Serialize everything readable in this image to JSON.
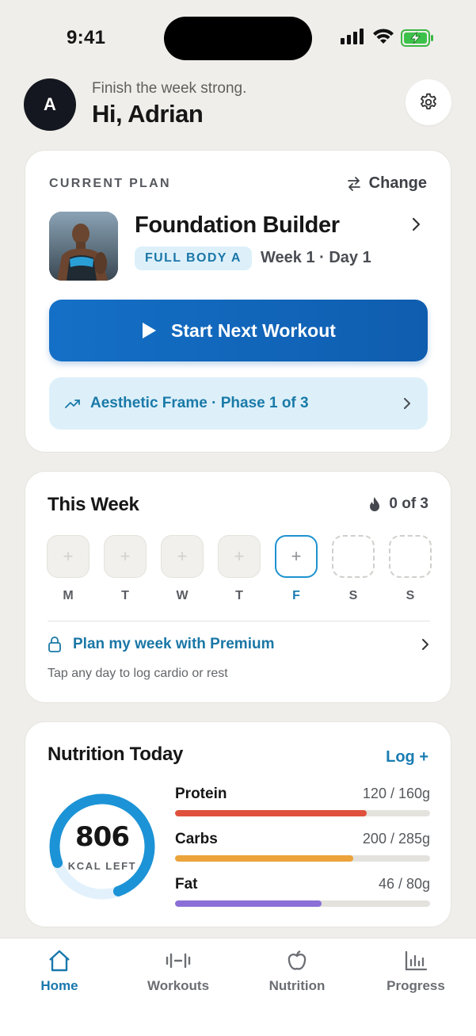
{
  "status": {
    "time": "9:41"
  },
  "header": {
    "avatar_initial": "A",
    "subtitle": "Finish the week strong.",
    "title": "Hi, Adrian"
  },
  "plan": {
    "section_label": "CURRENT PLAN",
    "change_label": "Change",
    "name": "Foundation Builder",
    "badge": "FULL BODY A",
    "week_day": "Week 1 · Day 1",
    "start_label": "Start Next Workout",
    "phase_label": "Aesthetic Frame · Phase 1 of 3"
  },
  "week": {
    "title": "This Week",
    "streak": "0 of 3",
    "days": [
      {
        "label": "M",
        "state": "past"
      },
      {
        "label": "T",
        "state": "past"
      },
      {
        "label": "W",
        "state": "past"
      },
      {
        "label": "T",
        "state": "past"
      },
      {
        "label": "F",
        "state": "today"
      },
      {
        "label": "S",
        "state": "future"
      },
      {
        "label": "S",
        "state": "future"
      }
    ],
    "add_glyph": "+",
    "premium_label": "Plan my week with Premium",
    "note": "Tap any day to log cardio or rest"
  },
  "nutrition": {
    "title": "Nutrition Today",
    "log_label": "Log +",
    "kcal_left": "806",
    "kcal_label": "KCAL LEFT",
    "kcal_progress": 0.75,
    "macros": [
      {
        "name": "Protein",
        "value": "120 / 160g",
        "progress": 0.75,
        "color": "#e0513d"
      },
      {
        "name": "Carbs",
        "value": "200 / 285g",
        "progress": 0.7,
        "color": "#eba33a"
      },
      {
        "name": "Fat",
        "value": "46 / 80g",
        "progress": 0.575,
        "color": "#8c6fd6"
      }
    ]
  },
  "tabs": [
    {
      "label": "Home",
      "icon": "home-icon",
      "active": true
    },
    {
      "label": "Workouts",
      "icon": "dumbbell-icon",
      "active": false
    },
    {
      "label": "Nutrition",
      "icon": "apple-icon",
      "active": false
    },
    {
      "label": "Progress",
      "icon": "bar-chart-icon",
      "active": false
    }
  ],
  "colors": {
    "accent": "#1a78ad",
    "primary_button": "#1467bd",
    "background": "#efeeea"
  }
}
